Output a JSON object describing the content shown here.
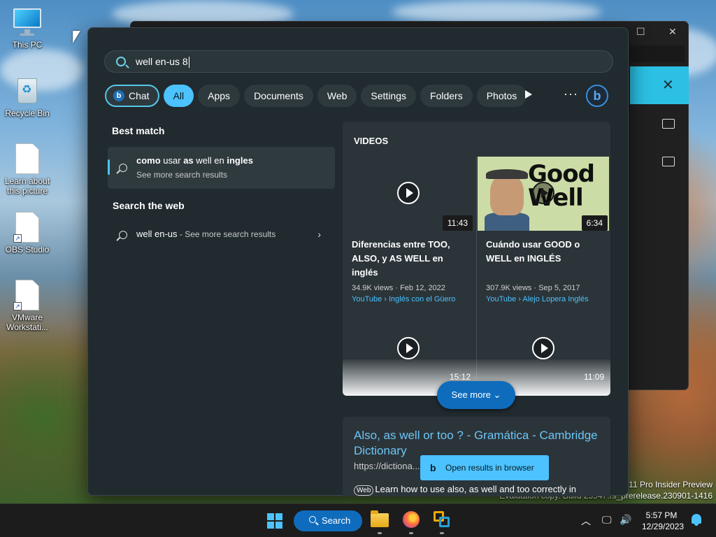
{
  "desktop": {
    "icons": [
      {
        "label": "This PC",
        "icon": "monitor-icon"
      },
      {
        "label": "Recycle Bin",
        "icon": "recycle-bin-icon"
      },
      {
        "label": "Learn about this picture",
        "icon": "file-icon"
      },
      {
        "label": "OBS Studio",
        "icon": "file-shortcut-icon"
      },
      {
        "label": "VMware Workstati...",
        "icon": "file-shortcut-icon"
      }
    ],
    "watermark_line1": "11 Pro Insider Preview",
    "watermark_line2": "Evaluation copy. Build 25947.rs_prerelease.230901-1416"
  },
  "search": {
    "query": "well en-us 8",
    "filters": [
      {
        "label": "Chat",
        "active": false
      },
      {
        "label": "All",
        "active": true
      },
      {
        "label": "Apps",
        "active": false
      },
      {
        "label": "Documents",
        "active": false
      },
      {
        "label": "Web",
        "active": false
      },
      {
        "label": "Settings",
        "active": false
      },
      {
        "label": "Folders",
        "active": false
      },
      {
        "label": "Photos",
        "active": false
      }
    ],
    "more_symbol": "···",
    "best_match": {
      "heading": "Best match",
      "title_parts": [
        {
          "text": "como",
          "bold": true
        },
        {
          "text": " usar ",
          "bold": false
        },
        {
          "text": "as",
          "bold": true
        },
        {
          "text": " well en ",
          "bold": false
        },
        {
          "text": "ingles",
          "bold": true
        }
      ],
      "subtitle": "See more search results"
    },
    "web": {
      "heading": "Search the web",
      "item_query": "well en-us",
      "item_suffix": " - See more search results",
      "chevron": "›"
    }
  },
  "videos": {
    "heading": "VIDEOS",
    "items": [
      {
        "duration": "11:43",
        "title": "Diferencias entre TOO, ALSO, y AS WELL en inglés",
        "meta": "34.9K views · Feb 12, 2022",
        "source": "YouTube › Inglés con el Güero"
      },
      {
        "duration": "6:34",
        "title": "Cuándo usar GOOD o WELL en INGLÉS",
        "meta": "307.9K views · Sep 5, 2017",
        "source": "YouTube › Alejo Lopera Inglés",
        "thumb_line1": "Good",
        "thumb_line2": "Well"
      },
      {
        "duration": "15:12"
      },
      {
        "duration": "11:09"
      }
    ],
    "see_more": "See more"
  },
  "web_result": {
    "title": "Also, as well or too ? - Gramática - Cambridge Dictionary",
    "url": "https://dictiona...a/gramati...",
    "tag": "Web",
    "description": "Learn how to use also, as well and too correctly in"
  },
  "toast": {
    "label": "Open results in browser"
  },
  "taskbar": {
    "search_label": "Search",
    "time": "5:57 PM",
    "date": "12/29/2023"
  },
  "colors": {
    "accent": "#4cc2ff",
    "search_button": "#0f6cbd",
    "panel_bg": "#202a2f",
    "link": "#6cc6f5"
  }
}
